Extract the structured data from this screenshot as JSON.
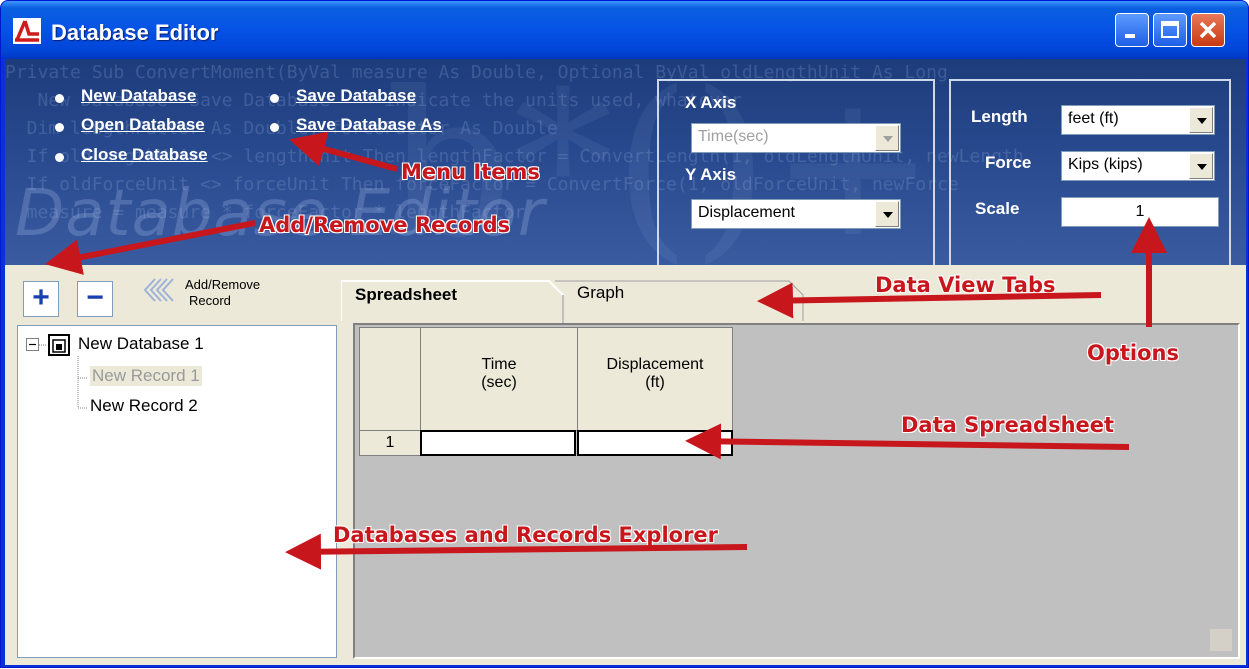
{
  "window": {
    "title": "Database Editor",
    "icon": "app-logo-icon",
    "controls": [
      "minimize-icon",
      "maximize-icon",
      "close-icon"
    ]
  },
  "header": {
    "background_code": [
      "Private Sub ConvertMoment(ByVal measure As Double, Optional ByVal oldLengthUnit As Long",
      "   New Database  Save Database   ' indicate the units used, whatever",
      "  Dim lengthFactor As Double, forceFactor As Double",
      "  If oldLengthUnit <> lengthUnit Then lengthFactor = ConvertLength(1, oldLengthUnit, newLength",
      "  If oldForceUnit <> forceUnit Then forceFactor = ConvertForce(1, oldForceUnit, newForce",
      "  measure = measure * forceFactor * lengthFactor"
    ],
    "watermark": "Database Editor",
    "menu_items": [
      "New Database",
      "Open Database",
      "Close Database",
      "Save Database",
      "Save Database As"
    ],
    "axis": {
      "x_label": "X Axis",
      "x_value": "Time(sec)",
      "y_label": "Y Axis",
      "y_value": "Displacement"
    },
    "options": {
      "length_label": "Length",
      "length_value": "feet (ft)",
      "force_label": "Force",
      "force_value": "Kips (kips)",
      "scale_label": "Scale",
      "scale_value": "1"
    }
  },
  "toolbar": {
    "add_glyph": "+",
    "remove_glyph": "−",
    "add_remove_label_line1": "Add/Remove",
    "add_remove_label_line2": "Record"
  },
  "tree": {
    "database": "New Database 1",
    "records": [
      "New Record 1",
      "New Record 2"
    ],
    "expander": "−"
  },
  "tabs": [
    "Spreadsheet",
    "Graph"
  ],
  "spreadsheet": {
    "columns": [
      {
        "line1": "Time",
        "line2": "(sec)"
      },
      {
        "line1": "Displacement",
        "line2": "(ft)"
      }
    ],
    "rows": [
      {
        "index": "1",
        "cells": [
          "",
          ""
        ]
      }
    ]
  },
  "annotations": {
    "menu_items": "Menu Items",
    "add_remove": "Add/Remove Records",
    "data_view_tabs": "Data View Tabs",
    "options": "Options",
    "data_spreadsheet": "Data Spreadsheet",
    "explorer": "Databases and Records Explorer"
  },
  "colors": {
    "title_bar": "#0653e6",
    "header_bg": "#28498e",
    "annotation_red": "#c8161d",
    "body_bg": "#ece9d8",
    "grid_bg": "#c0c0c0"
  }
}
